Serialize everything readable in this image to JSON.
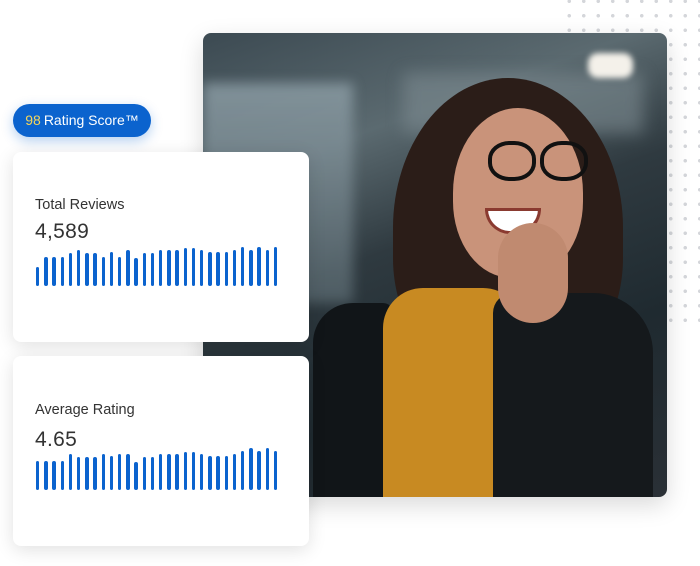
{
  "badge": {
    "score": "98",
    "label": "Rating Score™"
  },
  "colors": {
    "accent": "#0b63ce",
    "score": "#f6d65a"
  },
  "cards": [
    {
      "label": "Total Reviews",
      "value": "4,589",
      "bar_values": [
        19,
        29,
        29,
        29,
        33,
        36,
        33,
        33,
        29,
        34,
        29,
        36,
        28,
        33,
        33,
        36,
        36,
        36,
        38,
        38,
        36,
        34,
        34,
        34,
        36,
        39,
        36,
        39,
        36,
        39
      ]
    },
    {
      "label": "Average Rating",
      "value": "4.65",
      "bar_values": [
        29,
        29,
        29,
        29,
        36,
        33,
        33,
        33,
        36,
        34,
        36,
        36,
        28,
        33,
        33,
        36,
        36,
        36,
        38,
        38,
        36,
        34,
        34,
        34,
        36,
        39,
        42,
        39,
        42,
        39
      ]
    }
  ]
}
